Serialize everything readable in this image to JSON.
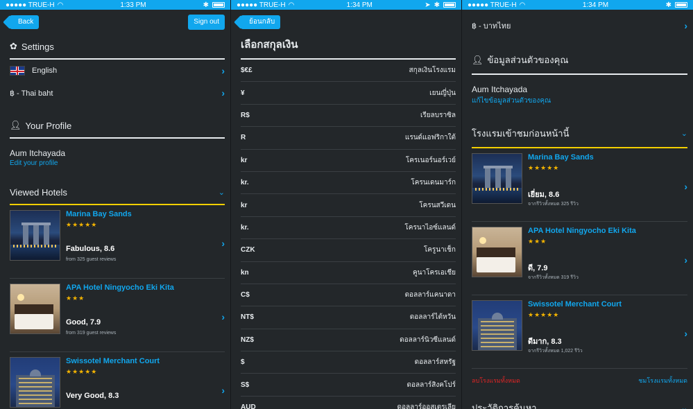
{
  "status": [
    {
      "carrier": "●●●●● TRUE-H",
      "time": "1:33 PM"
    },
    {
      "carrier": "●●●●● TRUE-H",
      "time": "1:34 PM"
    },
    {
      "carrier": "●●●●● TRUE-H",
      "time": "1:34 PM"
    }
  ],
  "panel1": {
    "back_label": "Back",
    "signout_label": "Sign out",
    "settings_title": "Settings",
    "language": "English",
    "currency": "฿ - Thai baht",
    "profile_title": "Your Profile",
    "profile_name": "Aum Itchayada",
    "profile_edit": "Edit your profile",
    "viewed_title": "Viewed Hotels",
    "hotels": [
      {
        "name": "Marina Bay Sands",
        "stars": "★★★★★",
        "rating": "Fabulous, 8.6",
        "reviews": "from 325 guest reviews"
      },
      {
        "name": "APA Hotel Ningyocho Eki Kita",
        "stars": "★★★",
        "rating": "Good, 7.9",
        "reviews": "from 319 guest reviews"
      },
      {
        "name": "Swissotel Merchant Court",
        "stars": "★★★★★",
        "rating": "Very Good, 8.3",
        "reviews": ""
      }
    ]
  },
  "panel2": {
    "back_label": "ย้อนกลับ",
    "title": "เลือกสกุลเงิน",
    "currencies": [
      {
        "code": "$€£",
        "name": "สกุลเงินโรงแรม"
      },
      {
        "code": "¥",
        "name": "เยนญี่ปุ่น"
      },
      {
        "code": "R$",
        "name": "เรียลบราซิล"
      },
      {
        "code": "R",
        "name": "แรนด์แอฟริกาใต้"
      },
      {
        "code": "kr",
        "name": "โครเนอร์นอร์เวย์"
      },
      {
        "code": "kr.",
        "name": "โครนเดนมาร์ก"
      },
      {
        "code": "kr",
        "name": "โครนสวีเดน"
      },
      {
        "code": "kr.",
        "name": "โครนาไอซ์แลนด์"
      },
      {
        "code": "CZK",
        "name": "โครูนาเช็ก"
      },
      {
        "code": "kn",
        "name": "คูนาโครเอเชีย"
      },
      {
        "code": "C$",
        "name": "ดอลลาร์แคนาดา"
      },
      {
        "code": "NT$",
        "name": "ดอลลาร์ไต้หวัน"
      },
      {
        "code": "NZ$",
        "name": "ดอลลาร์นิวซีแลนด์"
      },
      {
        "code": "$",
        "name": "ดอลลาร์สหรัฐ"
      },
      {
        "code": "S$",
        "name": "ดอลลาร์สิงคโปร์"
      },
      {
        "code": "AUD",
        "name": "ดอลลาร์ออสเตรเลีย"
      }
    ]
  },
  "panel3": {
    "currency": "฿ - บาทไทย",
    "profile_title": "ข้อมูลส่วนตัวของคุณ",
    "profile_name": "Aum Itchayada",
    "profile_edit": "แก้ไขข้อมูลส่วนตัวของคุณ",
    "viewed_title": "โรงแรมเข้าชมก่อนหน้านี้",
    "hotels": [
      {
        "name": "Marina Bay Sands",
        "stars": "★★★★★",
        "rating": "เยี่ยม, 8.6",
        "reviews": "จากรีวิวทั้งหมด 325 รีวิว"
      },
      {
        "name": "APA Hotel Ningyocho Eki Kita",
        "stars": "★★★",
        "rating": "ดี, 7.9",
        "reviews": "จากรีวิวทั้งหมด 319 รีวิว"
      },
      {
        "name": "Swissotel Merchant Court",
        "stars": "★★★★★",
        "rating": "ดีมาก, 8.3",
        "reviews": "จากรีวิวทั้งหมด 1,022 รีวิว"
      }
    ],
    "clear_link": "ลบโรงแรมทั้งหมด",
    "see_all_link": "ชมโรงแรมทั้งหมด",
    "history_title": "ประวัติการค้นหา"
  },
  "colors": {
    "accent": "#11a7ee",
    "divider_yellow": "#f4d000",
    "star": "#f4b400",
    "danger": "#e02525",
    "bg": "#23272a"
  }
}
